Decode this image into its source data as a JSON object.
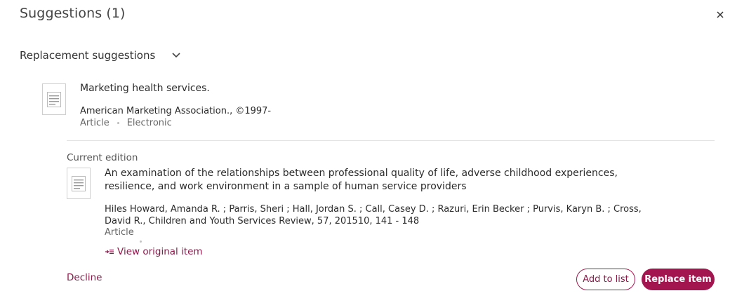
{
  "header": {
    "title": "Suggestions (1)",
    "close_icon": "close-icon"
  },
  "section": {
    "label": "Replacement suggestions",
    "toggle_icon": "chevron-down-icon"
  },
  "suggestion": {
    "thumbnail_icon": "document-thumbnail-icon",
    "title": "Marketing health services.",
    "publisher": "American Marketing Association., ©1997-",
    "type": "Article",
    "format": "Electronic"
  },
  "current_edition": {
    "label": "Current edition",
    "thumbnail_icon": "document-thumbnail-icon",
    "title": "An examination of the relationships between professional quality of life, adverse childhood experiences, resilience, and work environment in a sample of human service providers",
    "authors_source": "Hiles Howard, Amanda R. ; Parris, Sheri ; Hall, Jordan S. ; Call, Casey D. ; Razuri, Erin Becker ; Purvis, Karyn B. ; Cross, David R., Children and Youth Services Review, 57, 201510, 141 - 148",
    "type": "Article",
    "view_original_label": "View original item",
    "view_original_icon": "view-original-icon"
  },
  "actions": {
    "decline_label": "Decline",
    "add_to_list_label": "Add to list",
    "replace_label": "Replace item"
  },
  "colors": {
    "accent": "#a3154f",
    "link": "#8b1a4a"
  }
}
